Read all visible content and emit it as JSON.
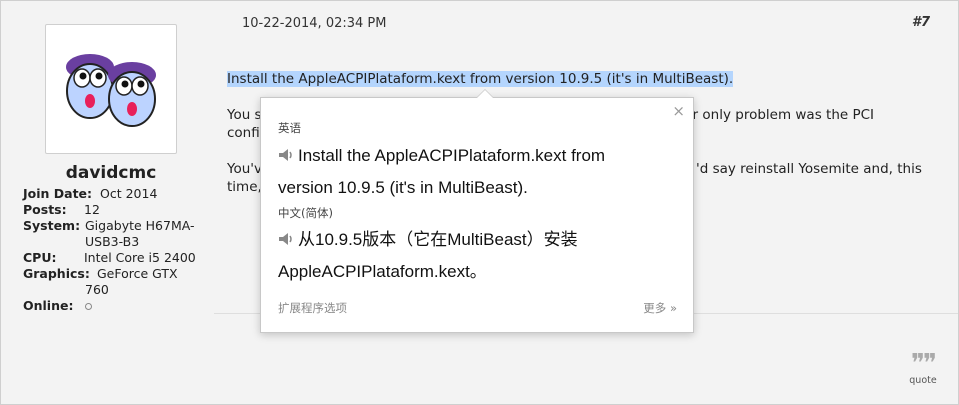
{
  "post": {
    "date": "10-22-2014, 02:34 PM",
    "number": "#7",
    "line1": "Install the AppleACPIPlataform.kext from version 10.9.5 (it's in MultiBeast).",
    "line2_left": "You s",
    "line2_right": "ur only problem was the PCI",
    "line3_left": "confi",
    "line4_left": "You'v",
    "line4_right": "'d say reinstall Yosemite and, this",
    "line5_left": "time,"
  },
  "user": {
    "name": "davidcmc",
    "info": [
      {
        "key": "Join Date:",
        "value": "Oct 2014"
      },
      {
        "key": "Posts:",
        "value": "12"
      },
      {
        "key": "System:",
        "value": "Gigabyte H67MA-"
      },
      {
        "key": "",
        "value": "USB3-B3"
      },
      {
        "key": "CPU:",
        "value": "Intel Core i5 2400"
      },
      {
        "key": "Graphics:",
        "value": "GeForce GTX"
      },
      {
        "key": "",
        "value": "760"
      },
      {
        "key": "Online:",
        "value": ""
      }
    ]
  },
  "quote": {
    "icon": "quote-icon",
    "label": "quote"
  },
  "translate": {
    "close": "×",
    "source_lang": "英语",
    "source_line1": "Install the AppleACPIPlataform.kext from",
    "source_line2": "version 10.9.5 (it's in MultiBeast).",
    "target_lang": "中文(简体)",
    "target_line1": "从10.9.5版本（它在MultiBeast）安装",
    "target_line2": "AppleACPIPlataform.kext。",
    "options": "扩展程序选项",
    "more": "更多 »"
  }
}
